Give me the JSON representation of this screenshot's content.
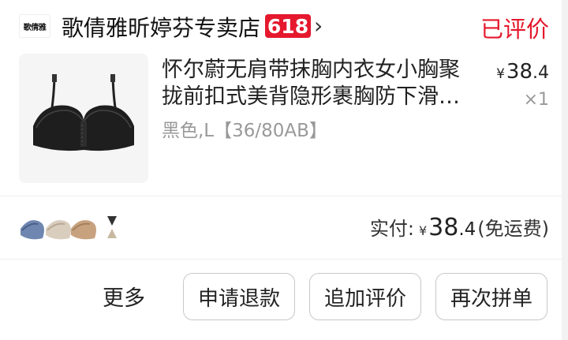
{
  "shop": {
    "logo_text": "歌倩雅",
    "name": "歌倩雅昕婷芬专卖店",
    "badge": "618",
    "review_status": "已评价"
  },
  "product": {
    "title_line1": "怀尔蔚无肩带抹胸内衣女小胸聚",
    "title_line2": "拢前扣式美背隐形裹胸防下滑…",
    "variant": "黑色,L【36/80AB】",
    "price": {
      "currency": "¥",
      "integer": "38",
      "decimal": ".4"
    },
    "quantity": "×1"
  },
  "summary": {
    "label": "实付:",
    "currency": "¥",
    "integer": "38",
    "decimal": ".4",
    "note": "(免运费)"
  },
  "actions": {
    "more": "更多",
    "refund": "申请退款",
    "add_review": "追加评价",
    "rebuy": "再次拼单"
  },
  "colors": {
    "accent_red": "#e5182d",
    "muted_text": "#999999",
    "divider": "#eeeeee"
  }
}
